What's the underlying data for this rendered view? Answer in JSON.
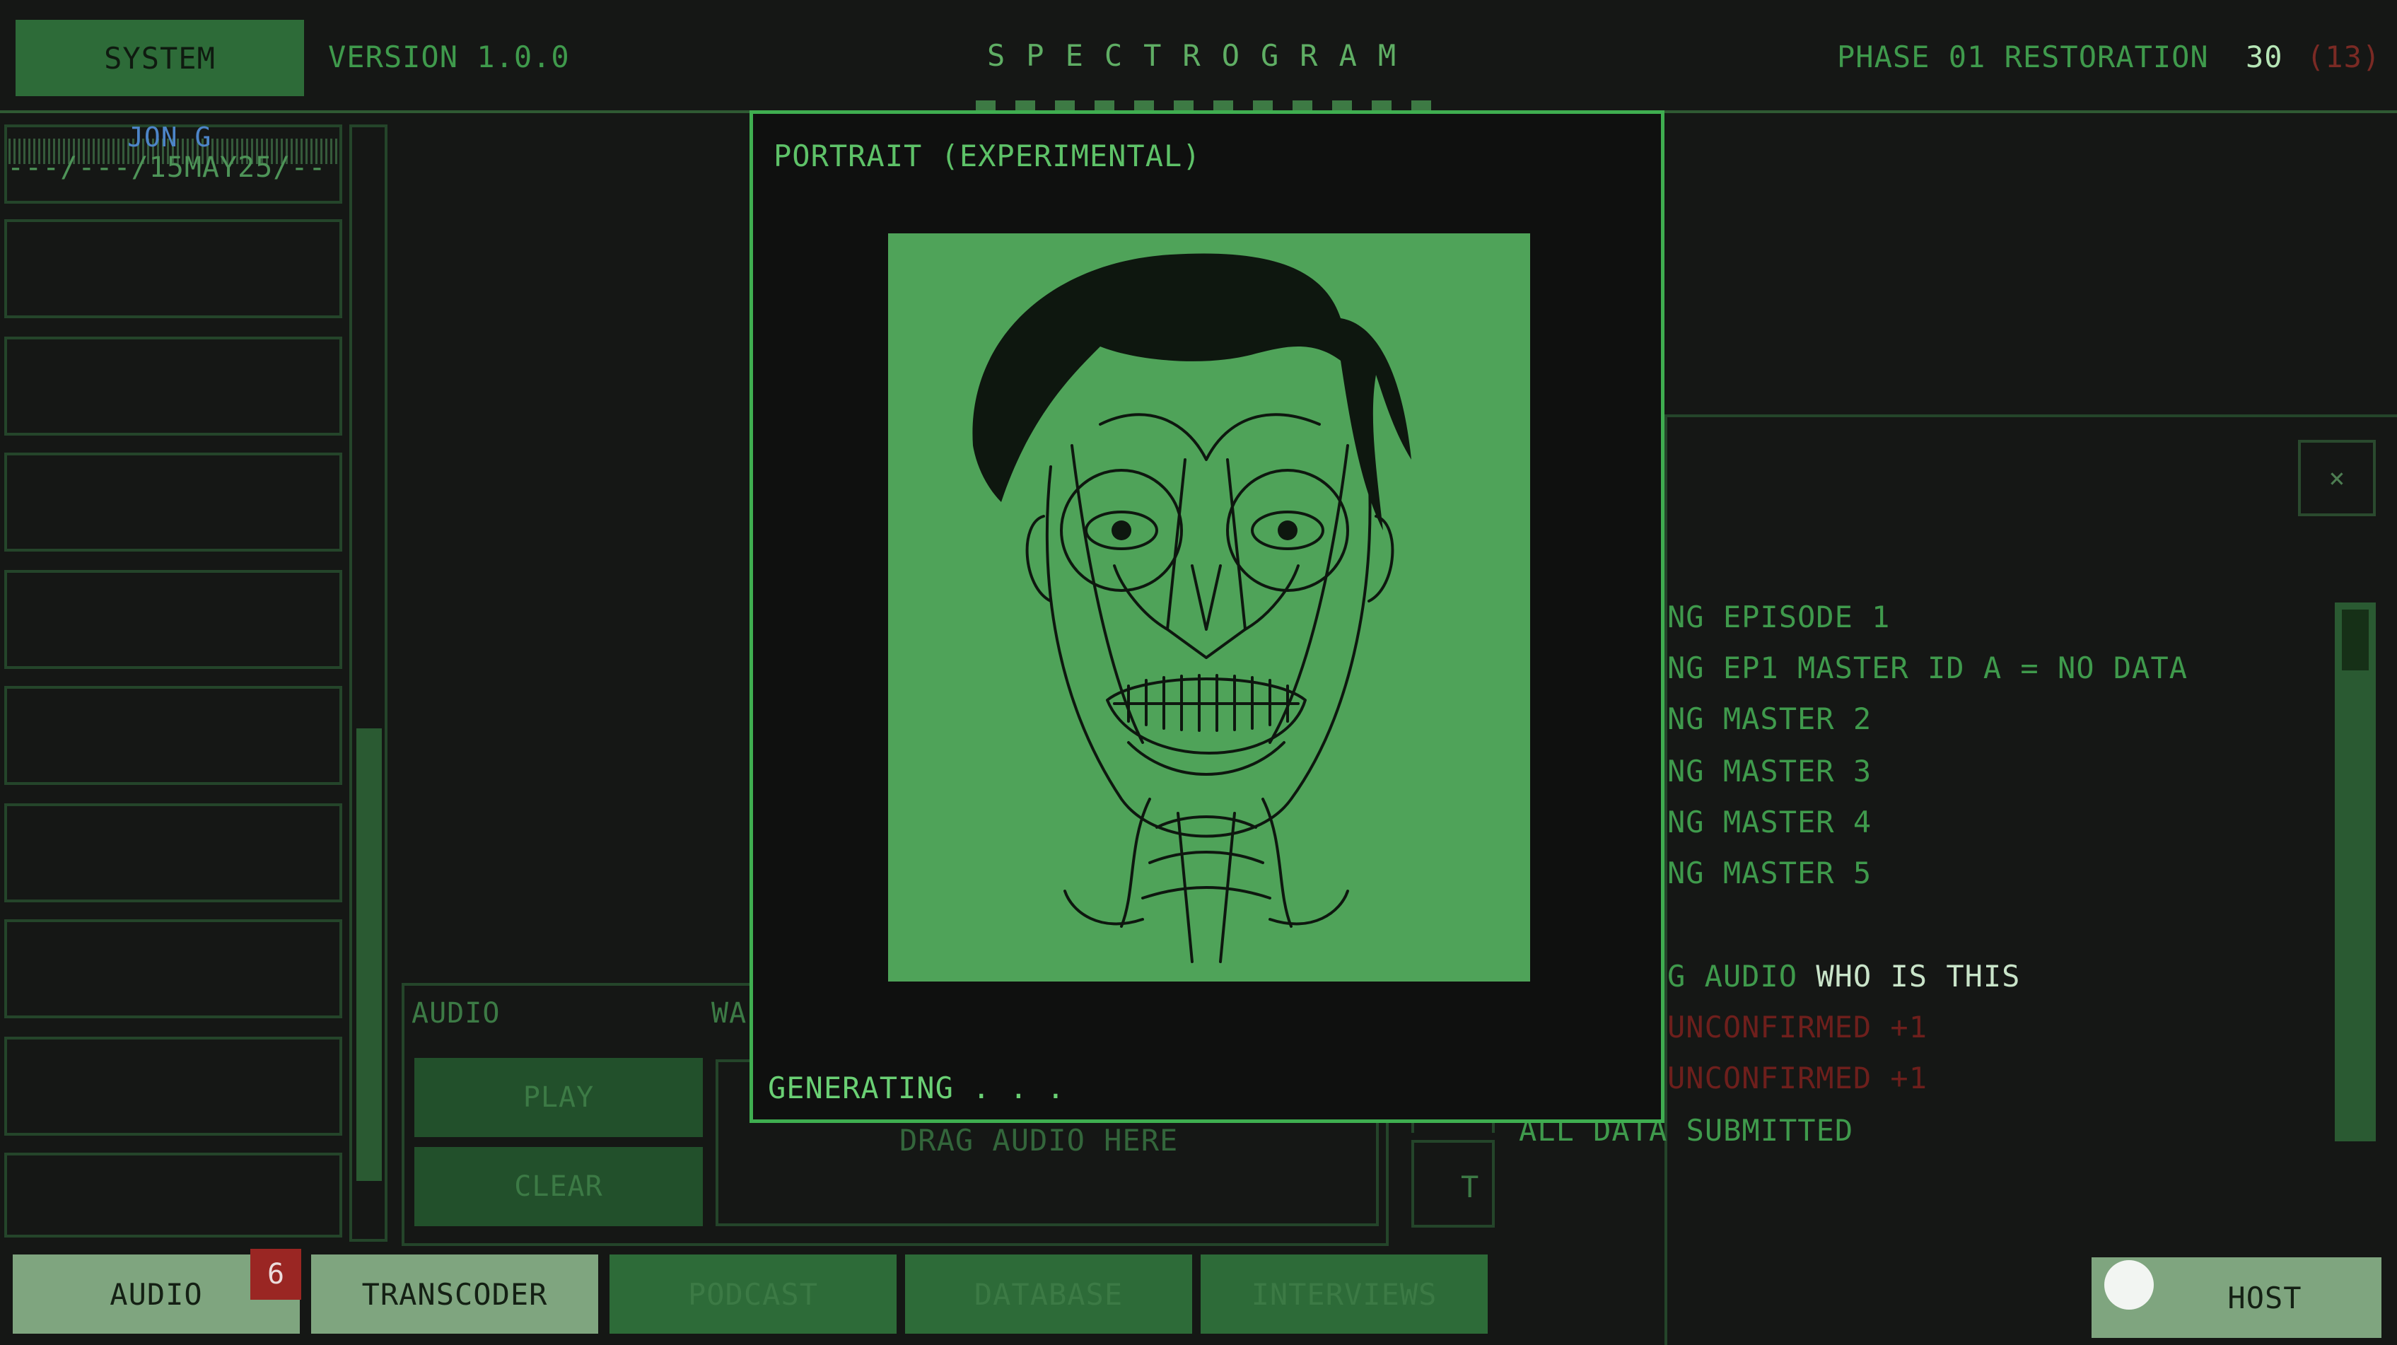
{
  "header": {
    "system_label": "SYSTEM",
    "version": "VERSION 1.0.0",
    "app_title": "SPECTROGRAM",
    "phase_label": "PHASE 01 RESTORATION",
    "phase_count": "30",
    "phase_paren": "(13)"
  },
  "sidebar": {
    "name": "JON G",
    "date": "---/---/15MAY25/--"
  },
  "audio_panel": {
    "audio_label": "AUDIO",
    "wa_label": "WA",
    "play_label": "PLAY",
    "clear_label": "CLEAR",
    "drop_text": "DRAG AUDIO HERE",
    "frag_text": "T"
  },
  "modal": {
    "title": "PORTRAIT (EXPERIMENTAL)",
    "status": "GENERATING . . ."
  },
  "log": {
    "close": "×",
    "lines": [
      "NG EPISODE 1",
      "NG EP1 MASTER ID A = NO DATA",
      "NG MASTER 2",
      "NG MASTER 3",
      "NG MASTER 4",
      "NG MASTER 5"
    ],
    "audio_prefix": "G AUDIO",
    "audio_who": "WHO IS THIS",
    "unconfirmed_1": "UNCONFIRMED +1",
    "unconfirmed_2": "UNCONFIRMED +1",
    "submitted": "ALL DATA SUBMITTED"
  },
  "tabs": {
    "audio": "AUDIO",
    "audio_badge": "6",
    "transcoder": "TRANSCODER",
    "podcast": "PODCAST",
    "database": "DATABASE",
    "interviews": "INTERVIEWS",
    "host": "HOST"
  },
  "colors": {
    "bg": "#151715",
    "accent": "#3fae50",
    "alert_red": "#9a2623"
  }
}
